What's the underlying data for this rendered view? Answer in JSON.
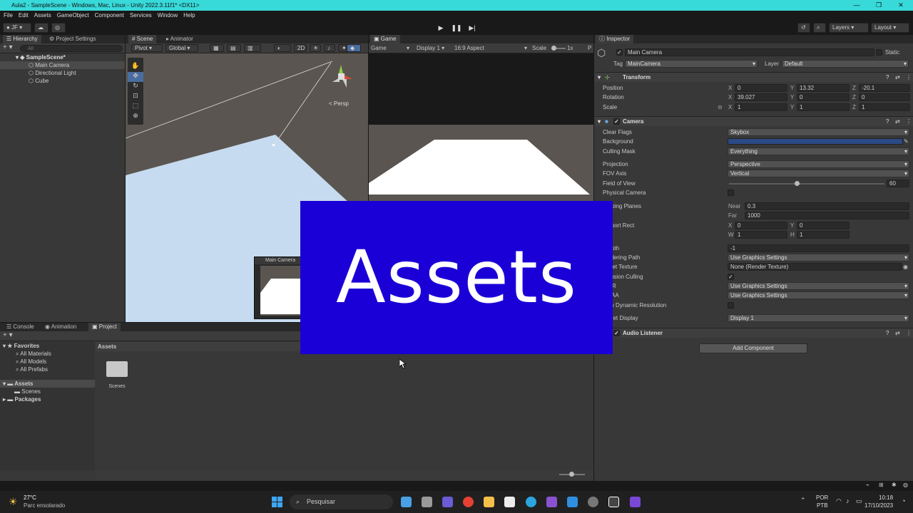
{
  "window": {
    "title": "Aula2 - SampleScene - Windows, Mac, Linux - Unity 2022.3.11f1* <DX11>"
  },
  "menu": [
    "File",
    "Edit",
    "Assets",
    "GameObject",
    "Component",
    "Services",
    "Window",
    "Help"
  ],
  "toolbar": {
    "account": "JF",
    "layers": "Layers",
    "layout": "Layout"
  },
  "hierarchy": {
    "tabs": [
      "Hierarchy",
      "Project Settings"
    ],
    "search_placeholder": "All",
    "scene": "SampleScene*",
    "items": [
      "Main Camera",
      "Directional Light",
      "Cube"
    ]
  },
  "scene_view": {
    "tabs": [
      "Scene",
      "Animator"
    ],
    "pivot": "Pivot",
    "global": "Global",
    "mode_2d": "2D",
    "persp": "< Persp",
    "camera_preview_title": "Main Camera"
  },
  "game_view": {
    "tab": "Game",
    "mode": "Game",
    "display": "Display 1",
    "aspect": "16:9 Aspect",
    "scale_label": "Scale",
    "scale_value": "1x",
    "play_focus": "P"
  },
  "overlay": {
    "text": "Assets",
    "bg": "#1a00d6"
  },
  "project": {
    "tabs": [
      "Console",
      "Animation",
      "Project"
    ],
    "favorites": "Favorites",
    "fav_items": [
      "All Materials",
      "All Models",
      "All Prefabs"
    ],
    "assets": "Assets",
    "asset_children": [
      "Scenes"
    ],
    "packages": "Packages",
    "breadcrumb": "Assets",
    "folder": "Scenes"
  },
  "inspector": {
    "tab": "Inspector",
    "object_name": "Main Camera",
    "static": "Static",
    "tag_label": "Tag",
    "tag": "MainCamera",
    "layer_label": "Layer",
    "layer": "Default",
    "transform": {
      "title": "Transform",
      "position_label": "Position",
      "rotation_label": "Rotation",
      "scale_label": "Scale",
      "position": {
        "x": "0",
        "y": "13.32",
        "z": "-20.1"
      },
      "rotation": {
        "x": "39.027",
        "y": "0",
        "z": "0"
      },
      "scale": {
        "x": "1",
        "y": "1",
        "z": "1"
      }
    },
    "camera": {
      "title": "Camera",
      "clear_flags_label": "Clear Flags",
      "clear_flags": "Skybox",
      "background_label": "Background",
      "background_color": "#2b4a86",
      "culling_mask_label": "Culling Mask",
      "culling_mask": "Everything",
      "projection_label": "Projection",
      "projection": "Perspective",
      "fov_axis_label": "FOV Axis",
      "fov_axis": "Vertical",
      "fov_label": "Field of View",
      "fov": "60",
      "fov_fraction": 0.42,
      "physical_label": "Physical Camera",
      "clipping_label": "ipping Planes",
      "near_label": "Near",
      "near": "0.3",
      "far_label": "Far",
      "far": "1000",
      "viewport_label": "wport Rect",
      "vx": "0",
      "vy": "0",
      "vw": "1",
      "vh": "1",
      "depth_label": "pth",
      "depth": "-1",
      "rendering_path_label": "ndering Path",
      "rendering_path": "Use Graphics Settings",
      "target_texture_label": "get Texture",
      "target_texture": "None (Render Texture)",
      "occlusion_label": "clusion Culling",
      "hdr_label": "R",
      "hdr": "Use Graphics Settings",
      "msaa_label": "AA",
      "msaa": "Use Graphics Settings",
      "dynres_label": "w Dynamic Resolution",
      "target_display_label": "get Display",
      "target_display": "Display 1"
    },
    "audio": {
      "title": "Audio Listener"
    },
    "add_component": "Add Component"
  },
  "taskbar": {
    "temp": "27°C",
    "weather": "Parc ensolarado",
    "search": "Pesquisar",
    "lang1": "POR",
    "lang2": "PTB",
    "time": "10:18",
    "date": "17/10/2023"
  }
}
